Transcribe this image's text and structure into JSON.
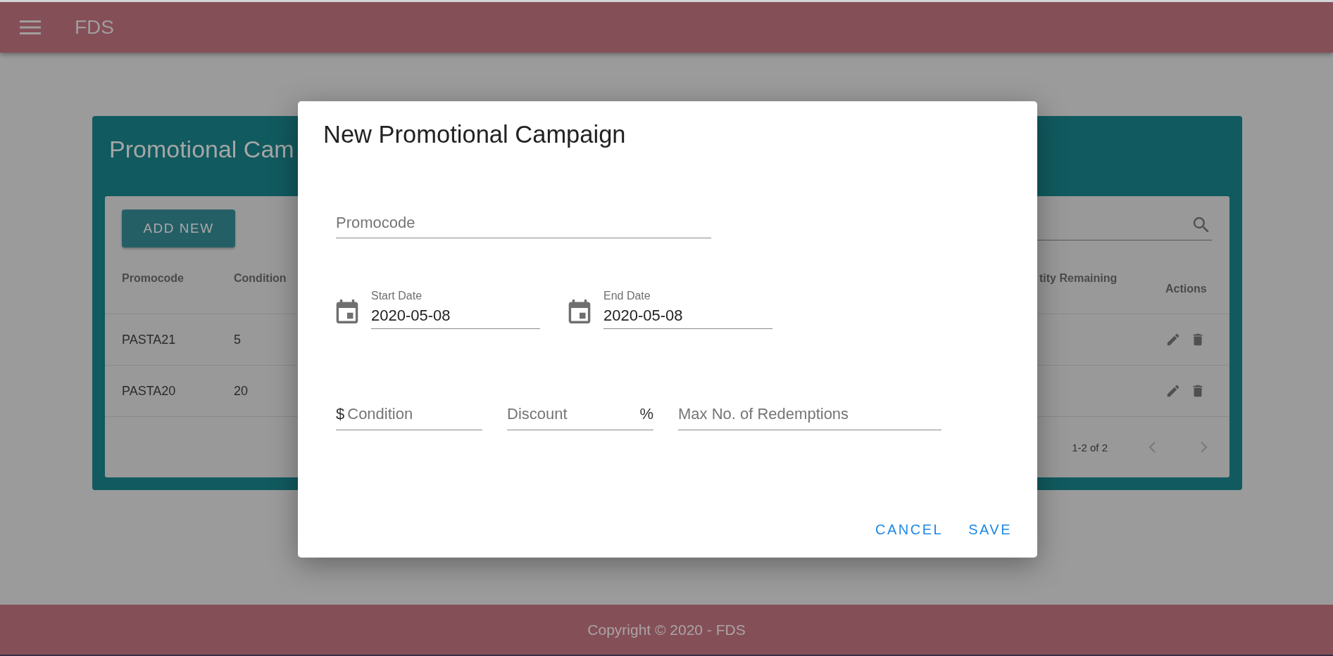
{
  "app_bar": {
    "title": "FDS"
  },
  "card": {
    "title": "Promotional Cam",
    "add_button": "ADD NEW",
    "columns": [
      "Promocode",
      "Condition",
      "tity Remaining",
      "Actions"
    ],
    "rows": [
      {
        "promocode": "PASTA21",
        "condition": "5"
      },
      {
        "promocode": "PASTA20",
        "condition": "20"
      }
    ],
    "pagination": "1-2 of 2",
    "page_buttons": [
      {
        "kind": "prev",
        "disabled": true
      },
      {
        "kind": "next",
        "disabled": true
      }
    ]
  },
  "dialog": {
    "title": "New Promotional Campaign",
    "promocode": {
      "placeholder": "Promocode"
    },
    "dates": [
      {
        "label": "Start Date",
        "value": "2020-05-08"
      },
      {
        "label": "End Date",
        "value": "2020-05-08"
      }
    ],
    "condition": {
      "prefix": "$",
      "placeholder": "Condition"
    },
    "discount": {
      "placeholder": "Discount",
      "suffix": "%"
    },
    "max_redemptions": {
      "placeholder": "Max No. of Redemptions"
    },
    "buttons": [
      "CANCEL",
      "SAVE"
    ]
  },
  "footer": "Copyright © 2020 - FDS"
}
